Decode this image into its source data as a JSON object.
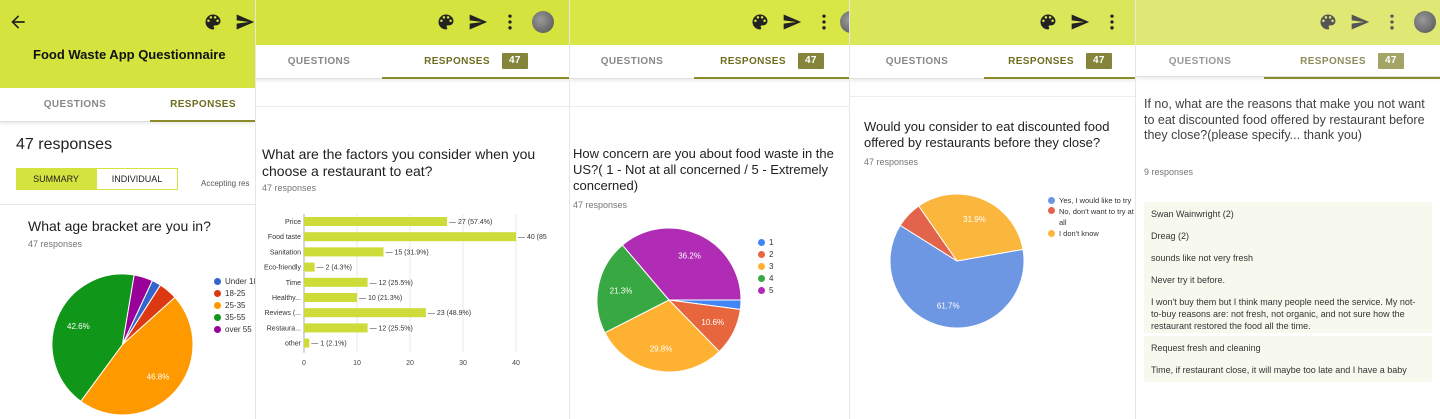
{
  "colors": {
    "accent_bar": "#d4e33d",
    "badge": "#84843a"
  },
  "icons": [
    "back-arrow-icon",
    "palette-icon",
    "send-icon",
    "more-vert-icon",
    "avatar"
  ],
  "p1": {
    "title": "Food Waste App Questionnaire",
    "tab_questions": "QUESTIONS",
    "tab_responses": "RESPONSES",
    "responses_count": "47 responses",
    "summary": "SUMMARY",
    "individual": "INDIVIDUAL",
    "accepting": "Accepting res",
    "question": "What age bracket are you in?",
    "resp": "47 responses",
    "legend": [
      "Under 18",
      "18-25",
      "25-35",
      "35-55",
      "over 55"
    ],
    "labels": [
      "42.6%",
      "46.8%"
    ]
  },
  "p2": {
    "tab_questions": "QUESTIONS",
    "tab_responses": "RESPONSES",
    "badge": "47",
    "question": "What are the factors you consider when you choose a restaurant to eat?",
    "resp": "47 responses"
  },
  "p3": {
    "tab_questions": "QUESTIONS",
    "tab_responses": "RESPONSES",
    "badge": "47",
    "question": "How concern are you about food waste in the US?( 1 - Not at all concerned / 5 - Extremely concerned)",
    "resp": "47 responses",
    "legend": [
      "1",
      "2",
      "3",
      "4",
      "5"
    ]
  },
  "p4": {
    "tab_questions": "QUESTIONS",
    "tab_responses": "RESPONSES",
    "badge": "47",
    "question": "Would you consider to eat discounted food offered by restaurants before they close?",
    "resp": "47 responses",
    "legend": [
      "Yes, I would like to try",
      "No, don't want to try at all",
      "I don't know"
    ]
  },
  "p5": {
    "tab_questions": "QUESTIONS",
    "tab_responses": "RESPONSES",
    "badge": "47",
    "question": "If no, what are the reasons that make you not want to eat discounted food offered by restaurant before they close?(please specify... thank you)",
    "resp": "9 responses",
    "answers": [
      "Swan Wainwright (2)",
      "Dreag (2)",
      "sounds like not very fresh",
      "Never try it before.",
      "I won't buy them but I think many people need the service. My not-to-buy reasons are: not fresh, not organic, and not sure how the restaurant restored the food all the time.",
      "Request fresh and cleaning",
      "Time, if restaurant close, it will maybe too late and I have a baby"
    ]
  },
  "chart_data": [
    {
      "type": "pie",
      "title": "What age bracket are you in?",
      "categories": [
        "Under 18",
        "18-25",
        "25-35",
        "35-55",
        "over 55"
      ],
      "values": [
        2.1,
        4.3,
        46.8,
        42.6,
        4.3
      ],
      "colors": [
        "#3366cc",
        "#dc3912",
        "#ff9900",
        "#109618",
        "#990099"
      ],
      "data_labels": [
        "",
        "",
        "46.8%",
        "42.6%",
        ""
      ]
    },
    {
      "type": "bar",
      "orientation": "horizontal",
      "title": "What are the factors you consider when you choose a restaurant to eat?",
      "categories": [
        "Price",
        "Food taste",
        "Sanitation",
        "Eco-friendly",
        "Time",
        "Healthy...",
        "Reviews (...",
        "Restaura...",
        "other"
      ],
      "values": [
        27,
        40,
        15,
        2,
        12,
        10,
        23,
        12,
        1
      ],
      "data_labels": [
        "27 (57.4%)",
        "40 (85",
        "15 (31.9%)",
        "2 (4.3%)",
        "12 (25.5%)",
        "10 (21.3%)",
        "23 (48.9%)",
        "12 (25.5%)",
        "1 (2.1%)"
      ],
      "xlim": [
        0,
        40
      ],
      "ticks": [
        "0",
        "10",
        "20",
        "30",
        "40"
      ],
      "color": "#cddc39"
    },
    {
      "type": "pie",
      "title": "How concern are you about food waste in the US?( 1 - Not at all concerned / 5 - Extremely concerned)",
      "categories": [
        "1",
        "2",
        "3",
        "4",
        "5"
      ],
      "values": [
        2.1,
        10.6,
        29.8,
        21.3,
        36.2
      ],
      "colors": [
        "#4285f4",
        "#e8663d",
        "#ffb232",
        "#38a842",
        "#b02cb5"
      ],
      "data_labels": [
        "",
        "10.6%",
        "29.8%",
        "21.3%",
        "36.2%"
      ]
    },
    {
      "type": "pie",
      "title": "Would you consider to eat discounted food offered by restaurants before they close?",
      "categories": [
        "Yes, I would like to try",
        "No, don't want to try at all",
        "I don't know"
      ],
      "values": [
        61.7,
        6.4,
        31.9
      ],
      "colors": [
        "#6d96e3",
        "#e2644a",
        "#fbb63e"
      ],
      "data_labels": [
        "61.7%",
        "",
        "31.9%"
      ]
    }
  ]
}
